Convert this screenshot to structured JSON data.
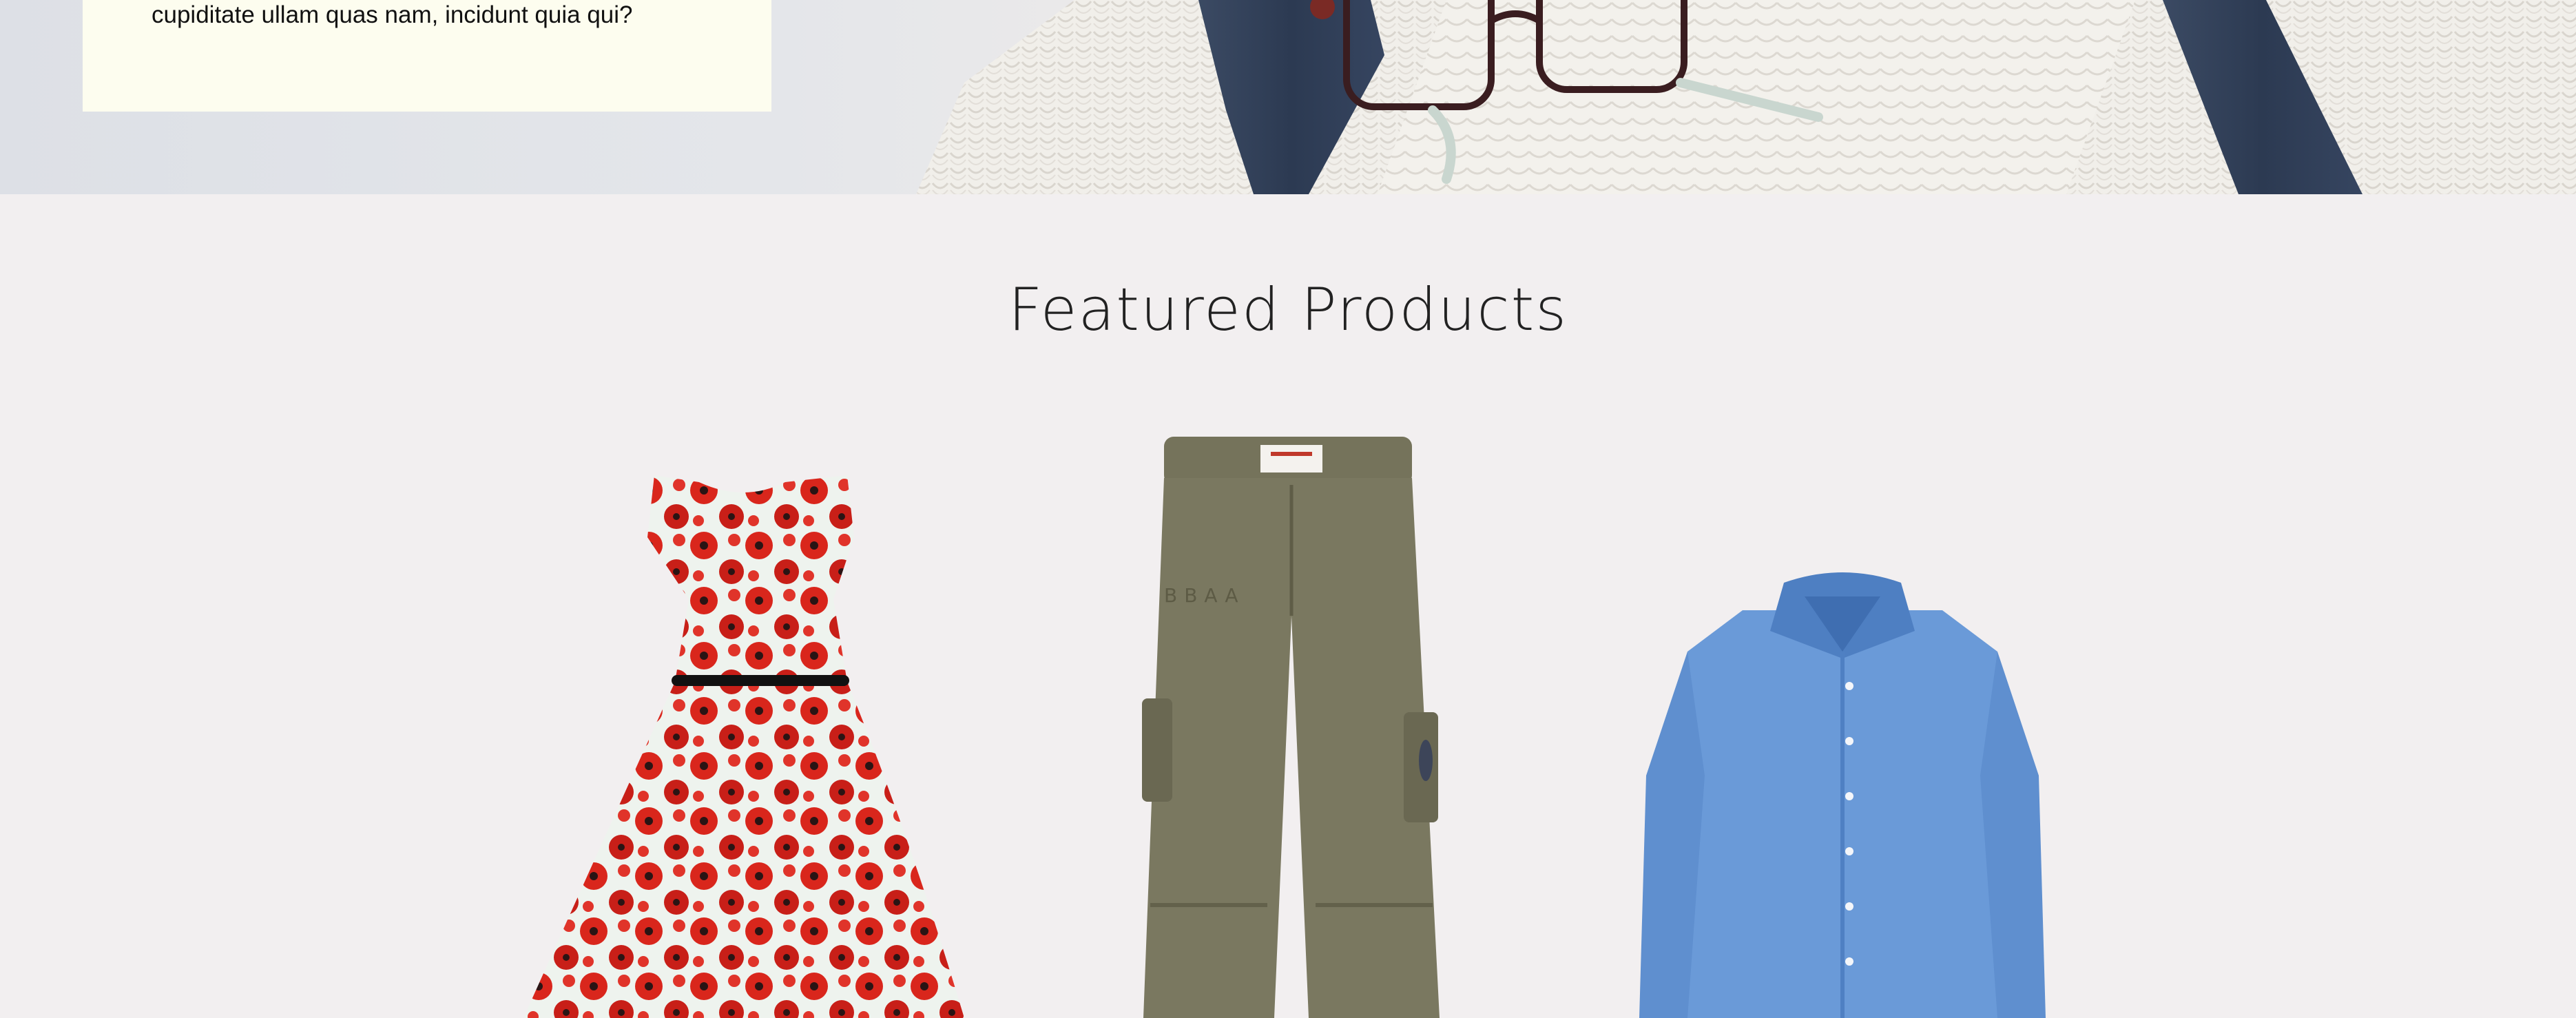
{
  "hero": {
    "text": "cupiditate ullam quas nam, incidunt quia qui?",
    "photo_icon": "sweater-glasses-jeans-photo"
  },
  "featured": {
    "title": "Featured Products",
    "products": [
      {
        "name": "floral-dress",
        "icon": "floral-dress-image"
      },
      {
        "name": "cargo-pants",
        "icon": "cargo-pants-image"
      },
      {
        "name": "blue-shirt",
        "icon": "blue-shirt-image"
      }
    ]
  },
  "colors": {
    "page_bg": "#f2eff0",
    "card_bg": "#fdfdef",
    "denim": "#2f3f5a",
    "knit": "#f1efec",
    "dress_red": "#d9261c",
    "pants_olive": "#7a7860",
    "shirt_blue": "#6a9ad8"
  }
}
